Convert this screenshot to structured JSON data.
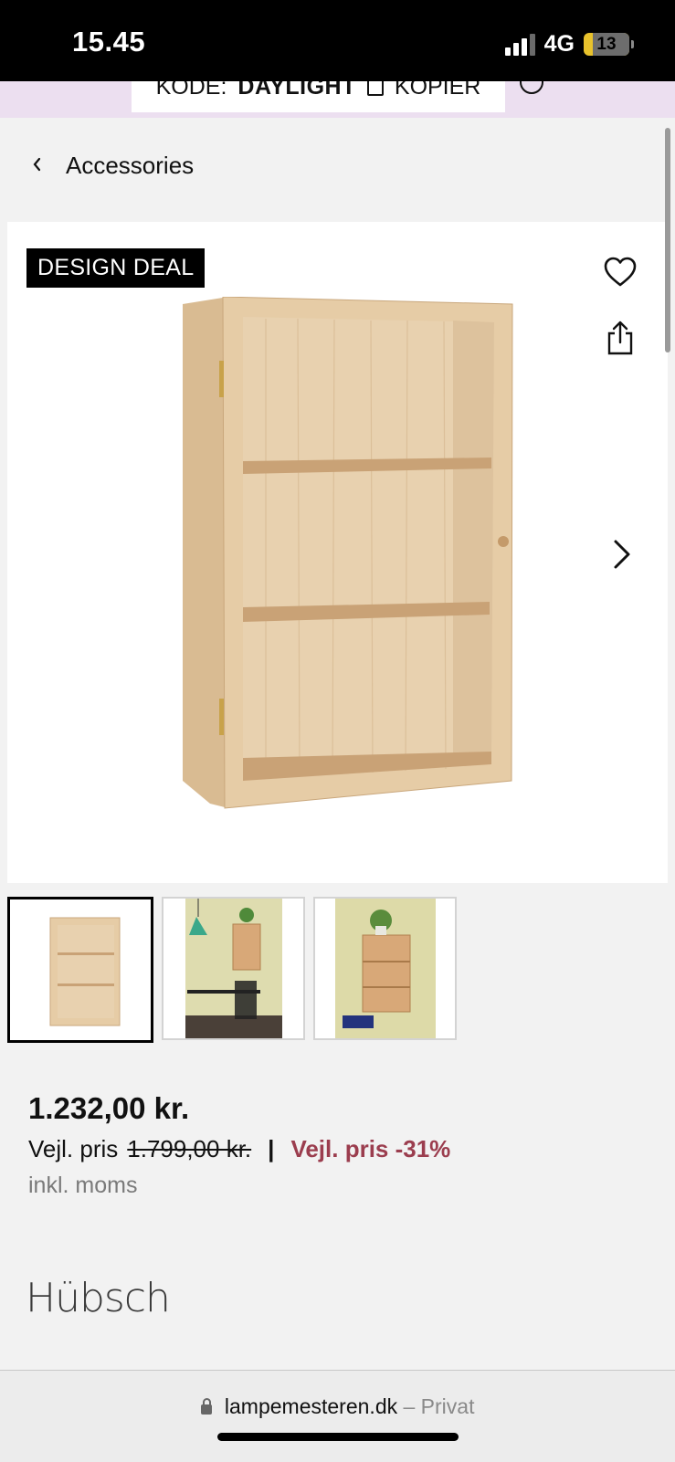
{
  "status_bar": {
    "time": "15.45",
    "network": "4G",
    "battery": "13"
  },
  "promo": {
    "code_label": "KODE:",
    "code": "DAYLIGHT",
    "copy_label": "KOPIER"
  },
  "breadcrumb": {
    "label": "Accessories"
  },
  "product": {
    "badge": "DESIGN DEAL",
    "price": "1.232,00 kr.",
    "rrp_label": "Vejl. pris",
    "rrp_value": "1.799,00 kr.",
    "separator": "|",
    "discount": "Vejl. pris -31%",
    "vat_note": "inkl. moms",
    "brand": "Hübsch",
    "thumbnails": [
      "cabinet-front",
      "cabinet-office-scene",
      "cabinet-wall-scene"
    ]
  },
  "browser": {
    "domain": "lampemesteren.dk",
    "mode": "– Privat"
  },
  "colors": {
    "discount": "#9b3d4e",
    "promo_bg": "#ecdff0",
    "wood": "#e3c9a5"
  }
}
